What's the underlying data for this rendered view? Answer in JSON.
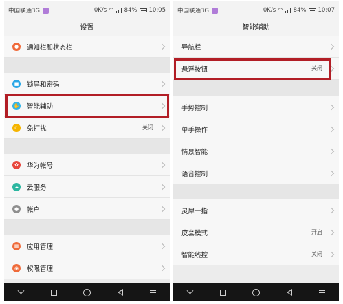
{
  "status_left": {
    "carrier": "中国联通3G",
    "net": "0K/s",
    "battery": "84%",
    "time": "10:05"
  },
  "status_right": {
    "carrier": "中国联通3G",
    "net": "0K/s",
    "battery": "84%",
    "time": "10:07"
  },
  "left": {
    "title": "设置",
    "rows": [
      {
        "label": "通知栏和状态栏",
        "icon": "bell-icon",
        "color": "#f06a3a",
        "value": ""
      },
      {
        "label": "锁屏和密码",
        "icon": "lock-icon",
        "color": "#2aa7e6",
        "value": ""
      },
      {
        "label": "智能辅助",
        "icon": "assist-icon",
        "color": "#35b5e8",
        "value": ""
      },
      {
        "label": "免打扰",
        "icon": "moon-icon",
        "color": "#f5b400",
        "value": "关闭"
      },
      {
        "label": "华为帐号",
        "icon": "huawei-icon",
        "color": "#e8473d",
        "value": ""
      },
      {
        "label": "云服务",
        "icon": "cloud-icon",
        "color": "#2cb6a0",
        "value": ""
      },
      {
        "label": "帐户",
        "icon": "account-icon",
        "color": "#8f8f8f",
        "value": ""
      },
      {
        "label": "应用管理",
        "icon": "apps-icon",
        "color": "#ef6b3a",
        "value": ""
      },
      {
        "label": "权限管理",
        "icon": "permission-icon",
        "color": "#ef6b3a",
        "value": ""
      }
    ]
  },
  "right": {
    "title": "智能辅助",
    "rows": [
      {
        "label": "导航栏",
        "value": ""
      },
      {
        "label": "悬浮按钮",
        "value": "关闭"
      },
      {
        "label": "手势控制",
        "value": ""
      },
      {
        "label": "单手操作",
        "value": ""
      },
      {
        "label": "情景智能",
        "value": ""
      },
      {
        "label": "语音控制",
        "value": ""
      },
      {
        "label": "灵犀一指",
        "value": ""
      },
      {
        "label": "皮套模式",
        "value": "开启"
      },
      {
        "label": "智能线控",
        "value": "关闭"
      }
    ]
  },
  "colors": {
    "highlight": "#b21e26",
    "sim_badge": "#b07cd8"
  }
}
